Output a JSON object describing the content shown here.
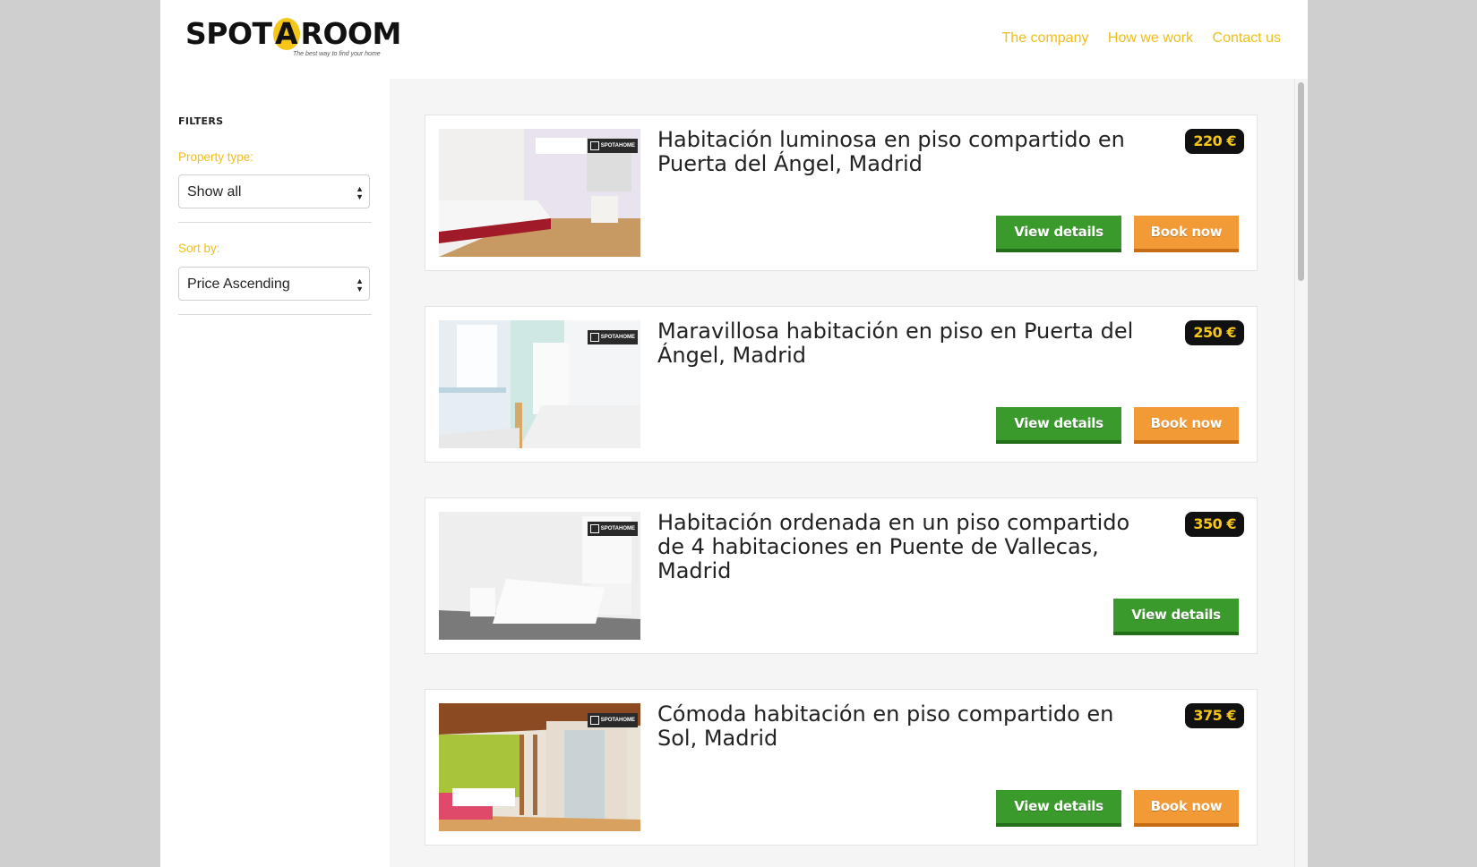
{
  "brand": {
    "logo_text_left": "SPOT",
    "logo_text_a": "A",
    "logo_text_right": "ROOM",
    "tagline": "The best way to find your home",
    "accent_color": "#f0be1a"
  },
  "nav": {
    "items": [
      {
        "label": "The company"
      },
      {
        "label": "How we work"
      },
      {
        "label": "Contact us"
      }
    ]
  },
  "filters": {
    "title": "Filters",
    "property_type_label": "Property type:",
    "property_type_value": "Show all",
    "sort_by_label": "Sort by:",
    "sort_by_value": "Price Ascending"
  },
  "listings": [
    {
      "title": "Habitación luminosa en piso compartido en Puerta del Ángel, Madrid",
      "price": "220 €",
      "view_label": "View details",
      "book_label": "Book now",
      "has_book": true,
      "watermark": "SPOTAHOME",
      "image": "bedroom-lilac-icon"
    },
    {
      "title": "Maravillosa habitación en piso en Puerta del Ángel, Madrid",
      "price": "250 €",
      "view_label": "View details",
      "book_label": "Book now",
      "has_book": true,
      "watermark": "SPOTAHOME",
      "image": "bedroom-desk-icon"
    },
    {
      "title": "Habitación ordenada en un piso compartido de 4 habitaciones en Puente de Vallecas, Madrid",
      "price": "350 €",
      "view_label": "View details",
      "book_label": "",
      "has_book": false,
      "watermark": "SPOTAHOME",
      "image": "bedroom-white-icon"
    },
    {
      "title": "Cómoda habitación en piso compartido en Sol, Madrid",
      "price": "375 €",
      "view_label": "View details",
      "book_label": "Book now",
      "has_book": true,
      "watermark": "SPOTAHOME",
      "image": "loft-room-icon"
    }
  ]
}
